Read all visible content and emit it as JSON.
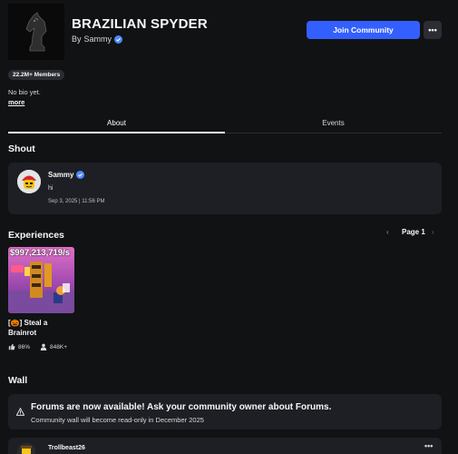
{
  "group": {
    "name": "BRAZILIAN SPYDER",
    "by_prefix": "By",
    "owner": "Sammy",
    "members": "22.2M+ Members",
    "bio": "No bio yet.",
    "more_label": "more"
  },
  "actions": {
    "join_label": "Join Community",
    "more_menu": "•••"
  },
  "tabs": [
    {
      "label": "About",
      "active": true
    },
    {
      "label": "Events",
      "active": false
    }
  ],
  "shout": {
    "heading": "Shout",
    "author": "Sammy",
    "message": "hi",
    "date": "Sep 3, 2025 | 11:56 PM"
  },
  "experiences": {
    "heading": "Experiences",
    "page_label": "Page 1",
    "prev_icon": "‹",
    "next_icon": "›",
    "items": [
      {
        "thumb_text": "$997,213,719/s",
        "name": "[🎃] Steal a Brainrot",
        "rating": "86%",
        "players": "848K+"
      }
    ]
  },
  "wall": {
    "heading": "Wall",
    "notice_title": "Forums are now available! Ask your community owner about Forums.",
    "notice_sub": "Community wall will become read-only in December 2025",
    "post_author": "Trollbeast26",
    "post_menu": "•••"
  },
  "colors": {
    "background": "#111214",
    "card": "#1e1f24",
    "accent": "#335fff"
  }
}
